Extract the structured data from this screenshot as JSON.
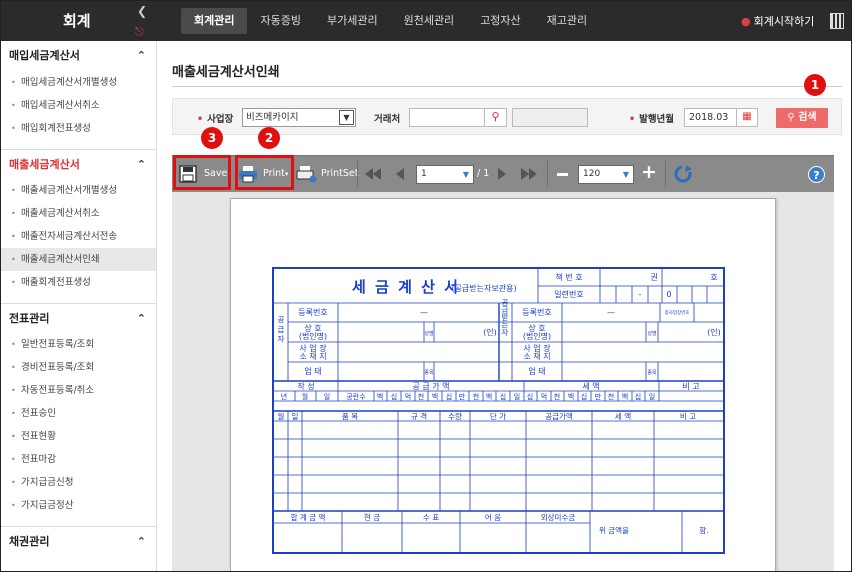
{
  "header": {
    "brand": "회계",
    "nav": [
      "회계관리",
      "자동증빙",
      "부가세관리",
      "원천세관리",
      "고정자산",
      "재고관리"
    ],
    "start_link": "회계시작하기"
  },
  "sidebar": {
    "sections": [
      {
        "title": "매입세금계산서",
        "items": [
          "매입세금계산서개별생성",
          "매입세금계산서취소",
          "매입회계전표생성"
        ]
      },
      {
        "title": "매출세금계산서",
        "items": [
          "매출세금계산서개별생성",
          "매출세금계산서취소",
          "매출전자세금계산서전송",
          "매출세금계산서인쇄",
          "매출회계전표생성"
        ]
      },
      {
        "title": "전표관리",
        "items": [
          "일반전표등록/조회",
          "경비전표등록/조회",
          "자동전표등록/취소",
          "전표승인",
          "전표현황",
          "전표마감",
          "가지급금신청",
          "가지급금정산"
        ]
      },
      {
        "title": "채권관리",
        "items": []
      }
    ]
  },
  "main": {
    "title": "매출세금계산서인쇄",
    "filter": {
      "biz_label": "사업장",
      "biz_value": "비즈메카이지",
      "partner_label": "거래처",
      "partner_value": "",
      "issue_label": "발행년월",
      "issue_value": "2018.03",
      "search_label": "검색"
    },
    "toolbar": {
      "save_label": "Save",
      "print_label": "Print",
      "printset_label": "PrintSet",
      "page_value": "1",
      "page_total": "/ 1",
      "zoom_value": "120"
    },
    "badges": [
      "1",
      "2",
      "3"
    ]
  },
  "invoice": {
    "title": "세 금 계 산 서",
    "subtitle": "(공급받는자보관용)",
    "book_no_label": "책 번 호",
    "book_kwon": "권",
    "book_ho": "호",
    "serial_label": "일련번호",
    "serial_dash": "-",
    "serial_zero": "0",
    "supplier_label": "공 급 자",
    "receiver_label": "공급받는자",
    "reg_no_label": "등록번호",
    "reg_dash": "—",
    "name_label": "상    호",
    "name_sub": "(법인명)",
    "ceo_label": "성명",
    "seal": "(인)",
    "addr_label": "사 업 장",
    "addr_sub": "소 재 지",
    "type_label": "업    태",
    "item_label": "종목",
    "branch_label": "종사업장번호",
    "write_label": "작    성",
    "supply_label": "공  급  가  액",
    "tax_label": "세      액",
    "note_label": "비  고",
    "ymd": [
      "년",
      "월",
      "일"
    ],
    "blank_count": "공란수",
    "digits": [
      "백",
      "십",
      "억",
      "천",
      "백",
      "십",
      "만",
      "천",
      "백",
      "십",
      "일"
    ],
    "tax_digits": [
      "십",
      "억",
      "천",
      "백",
      "십",
      "만",
      "천",
      "백",
      "십",
      "일"
    ],
    "line_headers": [
      "월",
      "일",
      "품      목",
      "규 격",
      "수량",
      "단  가",
      "공급가액",
      "세  액",
      "비  고"
    ],
    "footer": [
      "합 계 금 액",
      "현    금",
      "수    표",
      "어    음",
      "외상미수금",
      "위 금액을",
      "함."
    ]
  }
}
